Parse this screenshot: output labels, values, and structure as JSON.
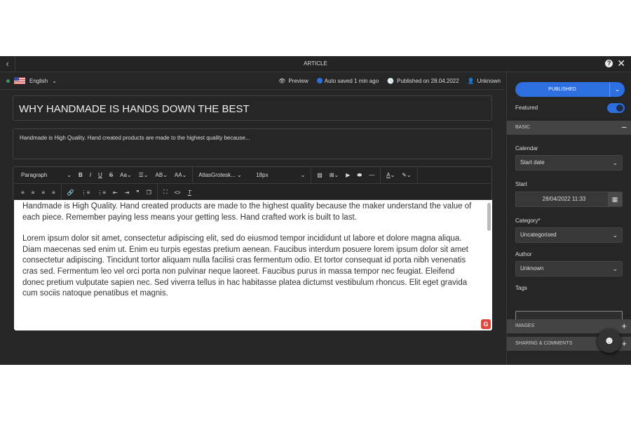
{
  "topbar": {
    "title": "ARTICLE",
    "back_icon": "chevron-left",
    "help_icon": "question-circle",
    "close_icon": "x"
  },
  "subbar": {
    "language": "English",
    "preview": "Preview",
    "autosave": "Auto saved 1 min ago",
    "published_label": "Published on",
    "published_date": "28.04.2022",
    "user": "Unknown"
  },
  "editor": {
    "heading": "WHY HANDMADE IS HANDS DOWN THE BEST",
    "excerpt": "Handmade is High Quality. Hand created products are made to the highest quality because...",
    "toolbar": {
      "block": "Paragraph",
      "font": "AtlasGrotesk...",
      "size": "18px"
    },
    "paragraphs": [
      "Handmade is High Quality. Hand created products are made to the highest quality because the maker understand the value of each piece. Remember paying less means your getting less. Hand crafted work is built to last.",
      "Lorem ipsum dolor sit amet, consectetur adipiscing elit, sed do eiusmod tempor incididunt ut labore et dolore magna aliqua. Diam maecenas sed enim ut. Enim eu turpis egestas pretium aenean. Faucibus interdum posuere lorem ipsum dolor sit amet consectetur adipiscing. Tincidunt tortor aliquam nulla facilisi cras fermentum odio. Et tortor consequat id porta nibh venenatis cras sed. Fermentum leo vel orci porta non pulvinar neque laoreet. Faucibus purus in massa tempor nec feugiat. Eleifend donec pretium vulputate sapien nec. Sed viverra tellus in hac habitasse platea dictumst vestibulum rhoncus. Elit eget gravida cum sociis natoque penatibus et magnis."
    ]
  },
  "sidebar": {
    "status": "PUBLISHED",
    "featured": "Featured",
    "featured_on": true,
    "basic": "BASIC",
    "calendar_label": "Calendar",
    "calendar_value": "Start date",
    "start_label": "Start",
    "start_value": "28/04/2022 11:33",
    "category_label": "Category*",
    "category_value": "Uncategorised",
    "author_label": "Author",
    "author_value": "Unknown",
    "tags_label": "Tags",
    "tags_value": "",
    "images": "IMAGES",
    "sharing": "SHARING & COMMENTS"
  },
  "colors": {
    "accent": "#2d6ee0",
    "bg": "#262626"
  }
}
